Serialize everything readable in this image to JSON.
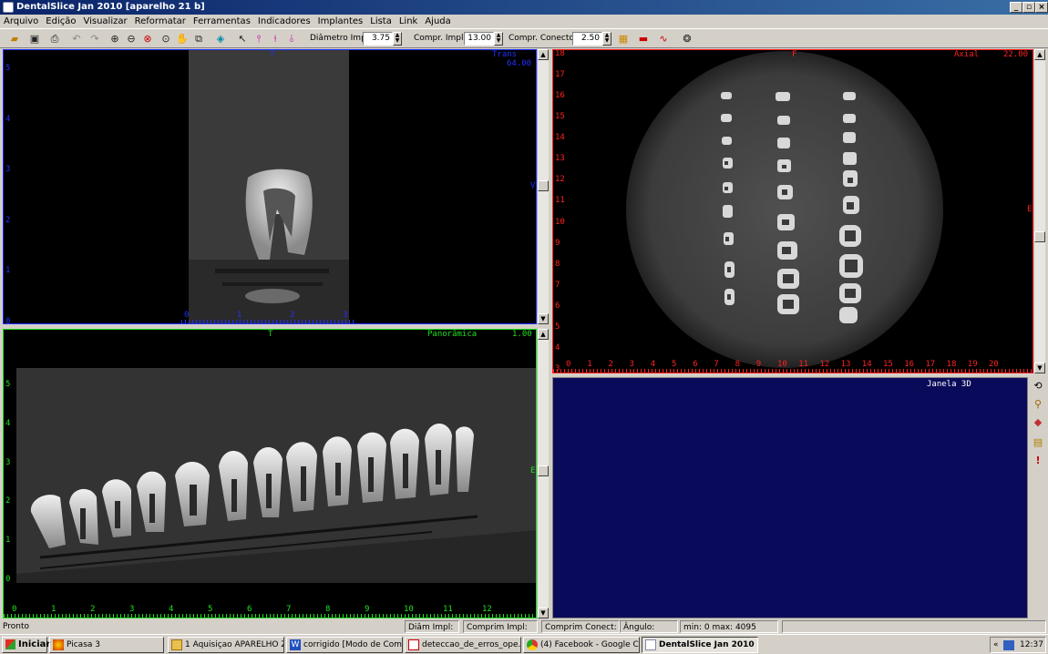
{
  "window": {
    "title": "DentalSlice Jan 2010 [aparelho 21 b]",
    "minimize": "_",
    "maximize": "▫",
    "close": "×"
  },
  "menu": [
    "Arquivo",
    "Edição",
    "Visualizar",
    "Reformatar",
    "Ferramentas",
    "Indicadores",
    "Implantes",
    "Lista",
    "Link",
    "Ajuda"
  ],
  "toolbar": {
    "diametro_label": "Diâmetro Impl:",
    "diametro_value": "3.75",
    "comprimento_label": "Compr. Impl:",
    "comprimento_value": "13.00",
    "conector_label": "Compr. Conector:",
    "conector_value": "2.50",
    "icons": [
      "open-folder-icon",
      "save-icon",
      "print-icon",
      "undo-icon",
      "redo-icon",
      "zoom-in-icon",
      "zoom-out-icon",
      "zoom-reset-icon",
      "zoom-window-icon",
      "pan-hand-icon",
      "zoom-fit-icon",
      "measure-icon",
      "select-arrow-icon",
      "implant-tool-1-icon",
      "implant-tool-2-icon",
      "implant-tool-3-icon",
      "implant-place-icon",
      "connector-icon",
      "angle-icon",
      "curve-icon",
      "settings-icon"
    ]
  },
  "views": {
    "transversal": {
      "title": "Trans",
      "value": "64.00",
      "top_marker": "T",
      "right_marker": "V",
      "left_scale": [
        "5",
        "4",
        "3",
        "2",
        "1",
        "0"
      ],
      "bottom_ticks": [
        "0",
        "1",
        "2",
        "3"
      ]
    },
    "axial": {
      "title": "Axial",
      "value": "22.00",
      "top_marker": "F",
      "right_marker": "E",
      "left_scale": [
        "18",
        "17",
        "16",
        "15",
        "14",
        "13",
        "12",
        "11",
        "10",
        "9",
        "8",
        "7",
        "6",
        "5",
        "4",
        "3"
      ],
      "bottom_scale": [
        "0",
        "1",
        "2",
        "3",
        "4",
        "5",
        "6",
        "7",
        "8",
        "9",
        "10",
        "11",
        "12",
        "13",
        "14",
        "15",
        "16",
        "17",
        "18",
        "19",
        "20"
      ]
    },
    "panoramica": {
      "title": "Panorâmica",
      "value": "1.00",
      "top_marker": "T",
      "right_marker": "E",
      "left_scale": [
        "5",
        "4",
        "3",
        "2",
        "1",
        "0"
      ],
      "bottom_scale": [
        "0",
        "1",
        "2",
        "3",
        "4",
        "5",
        "6",
        "7",
        "8",
        "9",
        "10",
        "11",
        "12"
      ]
    },
    "janela3d": {
      "title": "Janela 3D"
    }
  },
  "side_toolbar": [
    "rotate-icon",
    "binoculars-icon",
    "color-icon",
    "layers-icon",
    "alert-icon"
  ],
  "colors": {
    "trans": "#2030ff",
    "axial": "#ff2020",
    "panoramica": "#20e020",
    "janela3d_bg": "#0a0a5a"
  },
  "status": {
    "left": "Pronto",
    "diam": "Diâm Impl:",
    "compr": "Comprim Impl:",
    "conect": "Comprim Conect:",
    "angulo": "Ângulo:",
    "minmax": "min: 0  max: 4095"
  },
  "taskbar": {
    "start": "Iniciar",
    "tasks": [
      "Picasa 3",
      "1 Aquisiçao APARELHO Z",
      "corrigido [Modo de Comp...",
      "deteccao_de_erros_ope...",
      "(4) Facebook - Google C...",
      "DentalSlice Jan 2010 ..."
    ],
    "tray_chevron": "«",
    "clock": "12:37"
  }
}
